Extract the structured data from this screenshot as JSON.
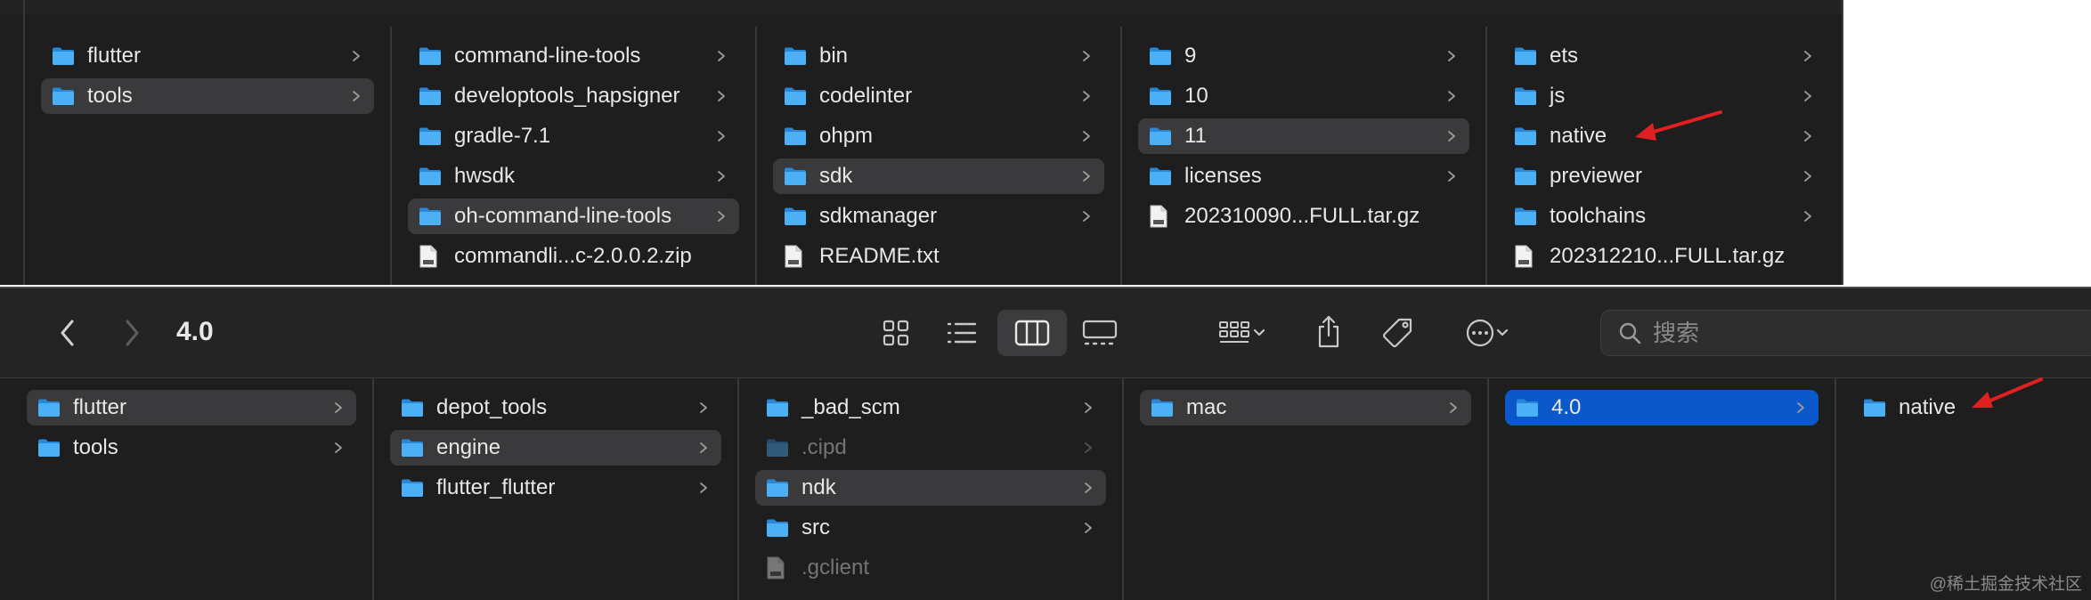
{
  "top_window": {
    "columns": [
      {
        "items": [
          {
            "label": "flutter",
            "icon": "folder",
            "selected": false,
            "chevron": true
          },
          {
            "label": "tools",
            "icon": "folder",
            "selected": true,
            "chevron": true
          }
        ]
      },
      {
        "items": [
          {
            "label": "command-line-tools",
            "icon": "folder",
            "selected": false,
            "chevron": true
          },
          {
            "label": "developtools_hapsigner",
            "icon": "folder",
            "selected": false,
            "chevron": true
          },
          {
            "label": "gradle-7.1",
            "icon": "folder",
            "selected": false,
            "chevron": true
          },
          {
            "label": "hwsdk",
            "icon": "folder",
            "selected": false,
            "chevron": true
          },
          {
            "label": "oh-command-line-tools",
            "icon": "folder",
            "selected": true,
            "chevron": true
          },
          {
            "label": "commandli...c-2.0.0.2.zip",
            "icon": "file",
            "selected": false,
            "chevron": false
          }
        ]
      },
      {
        "items": [
          {
            "label": "bin",
            "icon": "folder",
            "selected": false,
            "chevron": true
          },
          {
            "label": "codelinter",
            "icon": "folder",
            "selected": false,
            "chevron": true
          },
          {
            "label": "ohpm",
            "icon": "folder",
            "selected": false,
            "chevron": true
          },
          {
            "label": "sdk",
            "icon": "folder",
            "selected": true,
            "chevron": true
          },
          {
            "label": "sdkmanager",
            "icon": "folder",
            "selected": false,
            "chevron": true
          },
          {
            "label": "README.txt",
            "icon": "file",
            "selected": false,
            "chevron": false
          }
        ]
      },
      {
        "items": [
          {
            "label": "9",
            "icon": "folder",
            "selected": false,
            "chevron": true
          },
          {
            "label": "10",
            "icon": "folder",
            "selected": false,
            "chevron": true
          },
          {
            "label": "11",
            "icon": "folder",
            "selected": true,
            "chevron": true
          },
          {
            "label": "licenses",
            "icon": "folder",
            "selected": false,
            "chevron": true
          },
          {
            "label": "202310090...FULL.tar.gz",
            "icon": "file",
            "selected": false,
            "chevron": false
          }
        ]
      },
      {
        "items": [
          {
            "label": "ets",
            "icon": "folder",
            "selected": false,
            "chevron": true
          },
          {
            "label": "js",
            "icon": "folder",
            "selected": false,
            "chevron": true
          },
          {
            "label": "native",
            "icon": "folder",
            "selected": false,
            "chevron": true
          },
          {
            "label": "previewer",
            "icon": "folder",
            "selected": false,
            "chevron": true
          },
          {
            "label": "toolchains",
            "icon": "folder",
            "selected": false,
            "chevron": true
          },
          {
            "label": "202312210...FULL.tar.gz",
            "icon": "file",
            "selected": false,
            "chevron": false
          }
        ]
      }
    ]
  },
  "bottom_window": {
    "toolbar": {
      "title": "4.0",
      "back_icon": "chevron-left-icon",
      "forward_icon": "chevron-right-icon",
      "view_modes": [
        "icon-view-icon",
        "list-view-icon",
        "column-view-icon",
        "gallery-view-icon"
      ],
      "active_view": "column-view-icon",
      "search_placeholder": "搜索"
    },
    "columns": [
      {
        "items": [
          {
            "label": "flutter",
            "icon": "folder",
            "selected": true,
            "chevron": true
          },
          {
            "label": "tools",
            "icon": "folder",
            "selected": false,
            "chevron": true
          }
        ]
      },
      {
        "items": [
          {
            "label": "depot_tools",
            "icon": "folder",
            "selected": false,
            "chevron": true
          },
          {
            "label": "engine",
            "icon": "folder",
            "selected": true,
            "chevron": true
          },
          {
            "label": "flutter_flutter",
            "icon": "folder",
            "selected": false,
            "chevron": true
          }
        ]
      },
      {
        "items": [
          {
            "label": "_bad_scm",
            "icon": "folder",
            "selected": false,
            "chevron": true
          },
          {
            "label": ".cipd",
            "icon": "folder",
            "selected": false,
            "chevron": true,
            "dim": true
          },
          {
            "label": "ndk",
            "icon": "folder",
            "selected": true,
            "chevron": true
          },
          {
            "label": "src",
            "icon": "folder",
            "selected": false,
            "chevron": true
          },
          {
            "label": ".gclient",
            "icon": "file",
            "selected": false,
            "chevron": false,
            "dim": true
          }
        ]
      },
      {
        "items": [
          {
            "label": "mac",
            "icon": "folder",
            "selected": true,
            "chevron": true
          }
        ]
      },
      {
        "items": [
          {
            "label": "4.0",
            "icon": "folder",
            "selected": "blue",
            "chevron": true
          }
        ]
      },
      {
        "items": [
          {
            "label": "native",
            "icon": "folder",
            "selected": false,
            "chevron": false
          }
        ]
      }
    ]
  },
  "watermark": "@稀土掘金技术社区",
  "colors": {
    "window_bg": "#1e1e1e",
    "selection": "#3a3a3c",
    "active_selection": "#0a58ca",
    "folder_blue": "#3aa0f0",
    "annotation_arrow": "#e02020"
  }
}
